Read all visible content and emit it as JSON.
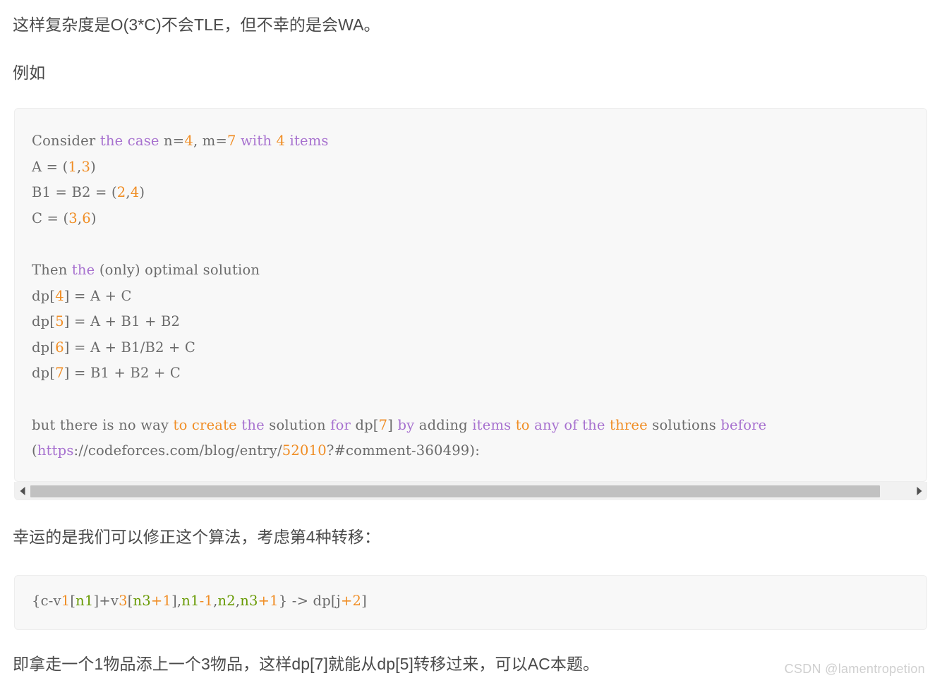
{
  "article": {
    "paragraphs": [
      "这样复杂度是O(3*C)不会TLE，但不幸的是会WA。",
      "例如",
      "幸运的是我们可以修正这个算法，考虑第4种转移：",
      "即拿走一个1物品添上一个3物品，这样dp[7]就能从dp[5]转移过来，可以AC本题。"
    ]
  },
  "code_block_main": {
    "lines": [
      {
        "tokens": [
          {
            "text": "Consider ",
            "type": "plain"
          },
          {
            "text": "the case",
            "type": "keyword"
          },
          {
            "text": " n=",
            "type": "plain"
          },
          {
            "text": "4",
            "type": "number"
          },
          {
            "text": ", m=",
            "type": "plain"
          },
          {
            "text": "7",
            "type": "number"
          },
          {
            "text": " with ",
            "type": "keyword"
          },
          {
            "text": "4",
            "type": "number"
          },
          {
            "text": " items",
            "type": "keyword"
          }
        ]
      },
      {
        "tokens": [
          {
            "text": "A = (",
            "type": "plain"
          },
          {
            "text": "1",
            "type": "number"
          },
          {
            "text": ",",
            "type": "plain"
          },
          {
            "text": "3",
            "type": "number"
          },
          {
            "text": ")",
            "type": "plain"
          }
        ]
      },
      {
        "tokens": [
          {
            "text": "B1 = B2 = (",
            "type": "plain"
          },
          {
            "text": "2",
            "type": "number"
          },
          {
            "text": ",",
            "type": "plain"
          },
          {
            "text": "4",
            "type": "number"
          },
          {
            "text": ")",
            "type": "plain"
          }
        ]
      },
      {
        "tokens": [
          {
            "text": "C = (",
            "type": "plain"
          },
          {
            "text": "3",
            "type": "number"
          },
          {
            "text": ",",
            "type": "plain"
          },
          {
            "text": "6",
            "type": "number"
          },
          {
            "text": ")",
            "type": "plain"
          }
        ]
      },
      {
        "tokens": []
      },
      {
        "tokens": [
          {
            "text": "Then ",
            "type": "plain"
          },
          {
            "text": "the",
            "type": "keyword"
          },
          {
            "text": " (only) optimal solution",
            "type": "plain"
          }
        ]
      },
      {
        "tokens": [
          {
            "text": "dp[",
            "type": "plain"
          },
          {
            "text": "4",
            "type": "number"
          },
          {
            "text": "] = A + C",
            "type": "plain"
          }
        ]
      },
      {
        "tokens": [
          {
            "text": "dp[",
            "type": "plain"
          },
          {
            "text": "5",
            "type": "number"
          },
          {
            "text": "] = A + B1 + B2",
            "type": "plain"
          }
        ]
      },
      {
        "tokens": [
          {
            "text": "dp[",
            "type": "plain"
          },
          {
            "text": "6",
            "type": "number"
          },
          {
            "text": "] = A + B1/B2 + C",
            "type": "plain"
          }
        ]
      },
      {
        "tokens": [
          {
            "text": "dp[",
            "type": "plain"
          },
          {
            "text": "7",
            "type": "number"
          },
          {
            "text": "] = B1 + B2 + C",
            "type": "plain"
          }
        ]
      },
      {
        "tokens": []
      },
      {
        "tokens": [
          {
            "text": "but there is no way ",
            "type": "plain"
          },
          {
            "text": "to create",
            "type": "number"
          },
          {
            "text": " the",
            "type": "keyword"
          },
          {
            "text": " solution ",
            "type": "plain"
          },
          {
            "text": "for",
            "type": "keyword"
          },
          {
            "text": " dp[",
            "type": "plain"
          },
          {
            "text": "7",
            "type": "number"
          },
          {
            "text": "]",
            "type": "plain"
          },
          {
            "text": " by",
            "type": "keyword"
          },
          {
            "text": " adding ",
            "type": "plain"
          },
          {
            "text": "items",
            "type": "keyword"
          },
          {
            "text": " to",
            "type": "number"
          },
          {
            "text": " any of",
            "type": "keyword"
          },
          {
            "text": " the",
            "type": "keyword"
          },
          {
            "text": " three",
            "type": "number"
          },
          {
            "text": " solutions ",
            "type": "plain"
          },
          {
            "text": "before",
            "type": "keyword"
          }
        ]
      },
      {
        "tokens": [
          {
            "text": "(",
            "type": "plain"
          },
          {
            "text": "https",
            "type": "keyword"
          },
          {
            "text": "://codeforces.com/blog/entry/",
            "type": "plain"
          },
          {
            "text": "52010",
            "type": "number"
          },
          {
            "text": "?#comment-360499):",
            "type": "plain"
          }
        ]
      }
    ],
    "scrollbar": {
      "left_arrow": "scroll-left-arrow",
      "right_arrow": "scroll-right-arrow",
      "thumb_position": "left",
      "orientation": "horizontal"
    }
  },
  "code_block_small": {
    "lines": [
      {
        "tokens": [
          {
            "text": "{c-v",
            "type": "plain"
          },
          {
            "text": "1",
            "type": "number"
          },
          {
            "text": "[",
            "type": "plain"
          },
          {
            "text": "n1",
            "type": "variable"
          },
          {
            "text": "]+v",
            "type": "plain"
          },
          {
            "text": "3",
            "type": "number"
          },
          {
            "text": "[",
            "type": "plain"
          },
          {
            "text": "n3",
            "type": "variable"
          },
          {
            "text": "+1",
            "type": "number"
          },
          {
            "text": "],",
            "type": "plain"
          },
          {
            "text": "n1",
            "type": "variable"
          },
          {
            "text": "-1",
            "type": "number"
          },
          {
            "text": ",",
            "type": "plain"
          },
          {
            "text": "n2",
            "type": "variable"
          },
          {
            "text": ",",
            "type": "plain"
          },
          {
            "text": "n3",
            "type": "variable"
          },
          {
            "text": "+1",
            "type": "number"
          },
          {
            "text": "} -> dp[j",
            "type": "plain"
          },
          {
            "text": "+2",
            "type": "number"
          },
          {
            "text": "]",
            "type": "plain"
          }
        ]
      }
    ]
  },
  "watermark": {
    "text": "CSDN @lamentropetion"
  },
  "colors": {
    "keyword": "#a771cf",
    "number": "#f08d24",
    "variable": "#669900",
    "code_text": "#6b6b6b",
    "code_background": "#f8f8f8",
    "body_text": "#4a4a4a",
    "watermark": "#cfcfcf",
    "scrollbar_thumb": "#c1c1c1",
    "scrollbar_track": "#f1f1f1"
  }
}
